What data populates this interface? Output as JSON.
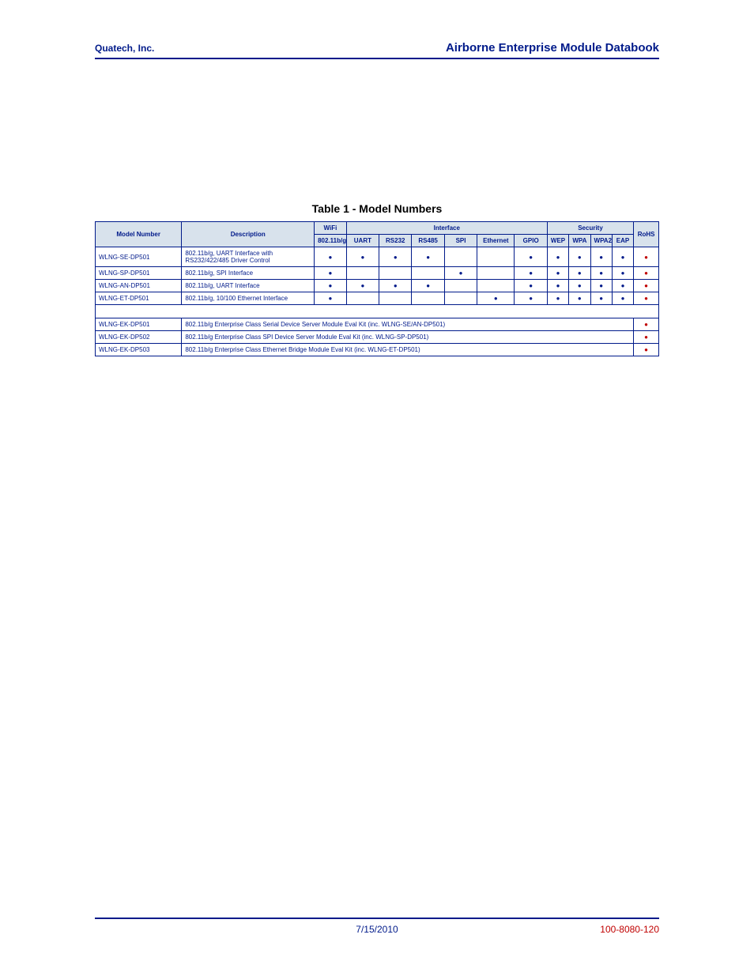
{
  "header": {
    "left": "Quatech, Inc.",
    "right": "Airborne Enterprise Module Databook"
  },
  "caption": "Table 1 - Model Numbers",
  "columns": {
    "model": "Model Number",
    "desc": "Description",
    "wifi_group": "WiFi",
    "wifi_sub": "802.11b/g",
    "if_group": "Interface",
    "if_uart": "UART",
    "if_rs232": "RS232",
    "if_rs485": "RS485",
    "if_spi": "SPI",
    "if_eth": "Ethernet",
    "if_gpio": "GPIO",
    "sec_group": "Security",
    "sec_wep": "WEP",
    "sec_wpa": "WPA",
    "sec_wpa2": "WPA2",
    "sec_eap": "EAP",
    "rohs": "RoHS"
  },
  "rows": [
    {
      "model": "WLNG-SE-DP501",
      "desc": "802.11b/g, UART Interface with RS232/422/485 Driver Control",
      "wifi": true,
      "uart": true,
      "rs232": true,
      "rs485": true,
      "spi": false,
      "eth": false,
      "gpio": true,
      "wep": true,
      "wpa": true,
      "wpa2": true,
      "eap": true,
      "rohs": true
    },
    {
      "model": "WLNG-SP-DP501",
      "desc": "802.11b/g, SPI Interface",
      "wifi": true,
      "uart": false,
      "rs232": false,
      "rs485": false,
      "spi": true,
      "eth": false,
      "gpio": true,
      "wep": true,
      "wpa": true,
      "wpa2": true,
      "eap": true,
      "rohs": true
    },
    {
      "model": "WLNG-AN-DP501",
      "desc": "802.11b/g, UART Interface",
      "wifi": true,
      "uart": true,
      "rs232": true,
      "rs485": true,
      "spi": false,
      "eth": false,
      "gpio": true,
      "wep": true,
      "wpa": true,
      "wpa2": true,
      "eap": true,
      "rohs": true
    },
    {
      "model": "WLNG-ET-DP501",
      "desc": "802.11b/g, 10/100 Ethernet Interface",
      "wifi": true,
      "uart": false,
      "rs232": false,
      "rs485": false,
      "spi": false,
      "eth": true,
      "gpio": true,
      "wep": true,
      "wpa": true,
      "wpa2": true,
      "eap": true,
      "rohs": true
    }
  ],
  "kit_rows": [
    {
      "model": "WLNG-EK-DP501",
      "desc": "802.11b/g Enterprise Class Serial Device Server Module Eval Kit (inc. WLNG-SE/AN-DP501)",
      "rohs": true
    },
    {
      "model": "WLNG-EK-DP502",
      "desc": "802.11b/g Enterprise Class SPI Device Server Module Eval Kit (inc. WLNG-SP-DP501)",
      "rohs": true
    },
    {
      "model": "WLNG-EK-DP503",
      "desc": "802.11b/g Enterprise Class Ethernet Bridge Module Eval Kit (inc. WLNG-ET-DP501)",
      "rohs": true
    }
  ],
  "footer": {
    "date": "7/15/2010",
    "doc": "100-8080-120"
  }
}
